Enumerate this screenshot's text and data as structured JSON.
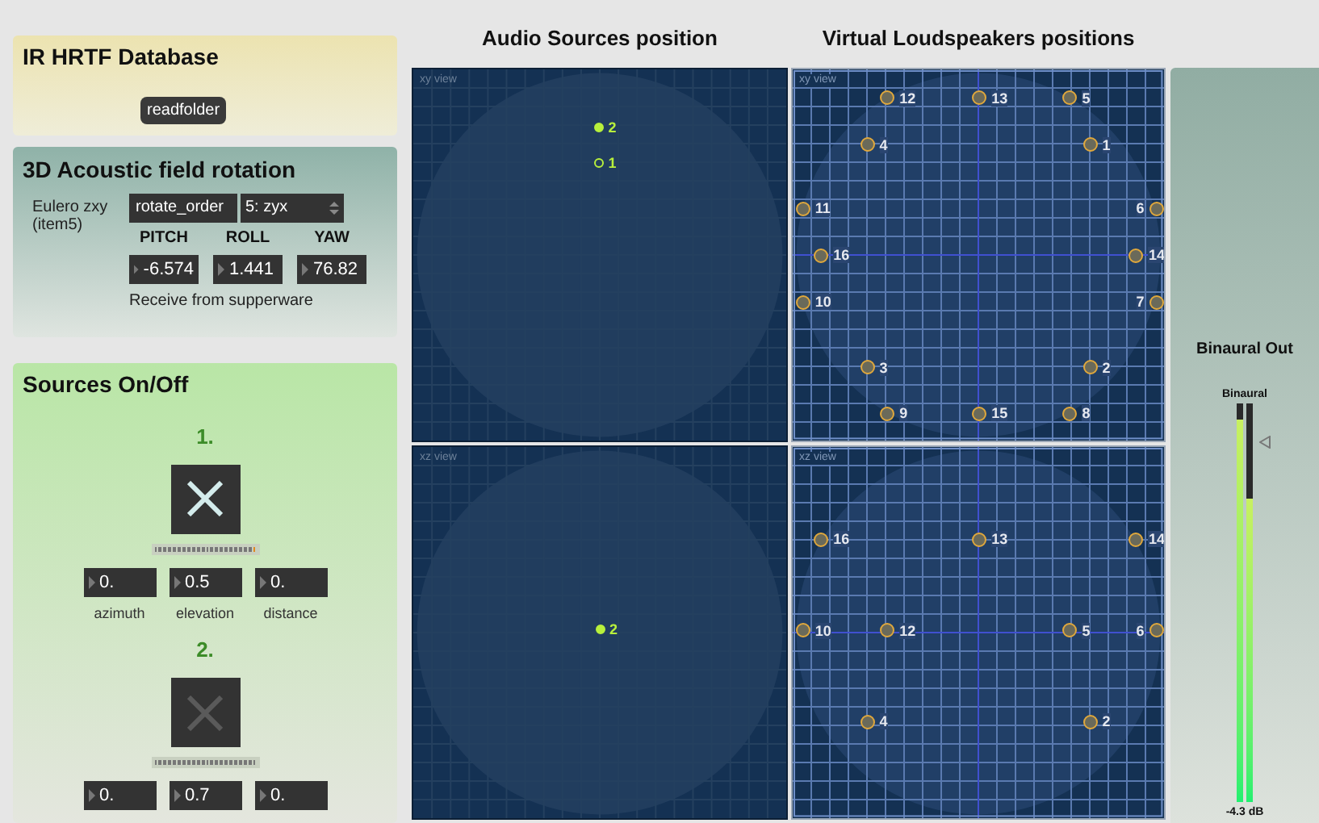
{
  "ir_database": {
    "title": "IR HRTF Database",
    "button": "readfolder"
  },
  "rotation": {
    "title": "3D Acoustic field rotation",
    "mode_label": "Eulero zxy (item5)",
    "message": "rotate_order",
    "order_menu": {
      "value": "5: zyx"
    },
    "angles": [
      {
        "label": "PITCH",
        "value": "-6.574"
      },
      {
        "label": "ROLL",
        "value": "1.441"
      },
      {
        "label": "YAW",
        "value": "76.82"
      }
    ],
    "note": "Receive from supperware"
  },
  "sources_panel": {
    "title": "Sources On/Off",
    "sources": [
      {
        "number": "1.",
        "on": true,
        "fields": [
          {
            "value": "0.",
            "label": "azimuth"
          },
          {
            "value": "0.5",
            "label": "elevation"
          },
          {
            "value": "0.",
            "label": "distance"
          }
        ]
      },
      {
        "number": "2.",
        "on": false,
        "fields": [
          {
            "value": "0."
          },
          {
            "value": "0.7"
          },
          {
            "value": "0."
          }
        ]
      }
    ]
  },
  "sources_view": {
    "title": "Audio Sources position",
    "views": [
      {
        "label": "xy view",
        "sources": [
          {
            "label": "2",
            "filled": true
          },
          {
            "label": "1",
            "filled": false
          }
        ]
      },
      {
        "label": "xz view",
        "sources": [
          {
            "label": "2",
            "filled": true
          }
        ]
      }
    ]
  },
  "speakers_view": {
    "title": "Virtual Loudspeakers positions",
    "views": [
      {
        "label": "xy view",
        "speakers": [
          "12",
          "13",
          "5",
          "4",
          "1",
          "11",
          "6",
          "16",
          "14",
          "10",
          "7",
          "3",
          "2",
          "9",
          "15",
          "8"
        ]
      },
      {
        "label": "xz view",
        "speakers": [
          "16",
          "13",
          "14",
          "10",
          "12",
          "5",
          "6",
          "4",
          "2"
        ]
      }
    ]
  },
  "output": {
    "title": "Binaural Out",
    "meter_label": "Binaural",
    "channels": [
      {
        "level": 0.96
      },
      {
        "level": 0.76
      }
    ],
    "reading": "-4.3 dB"
  }
}
